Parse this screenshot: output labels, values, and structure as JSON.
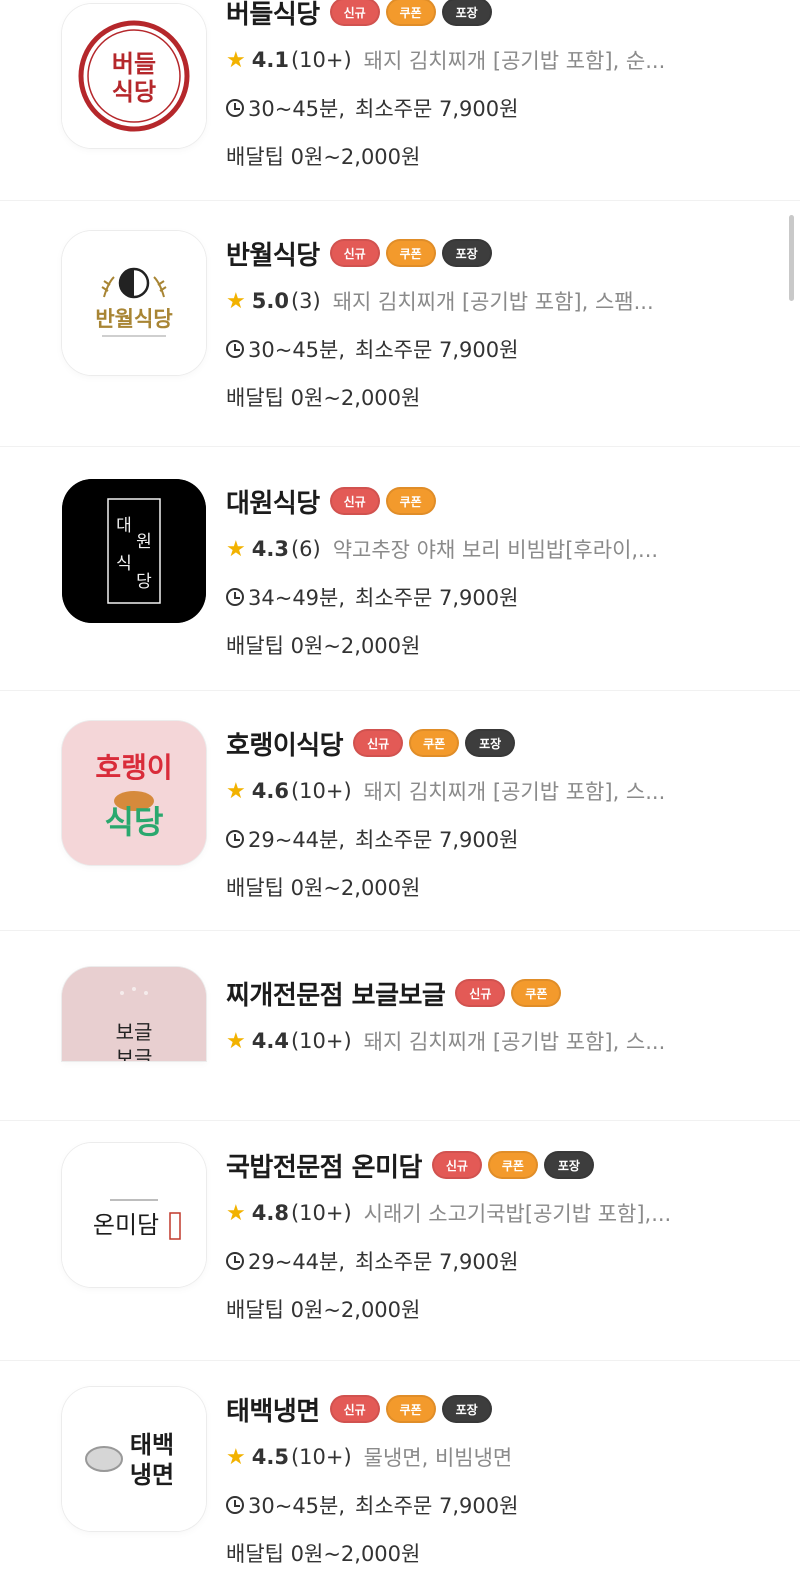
{
  "badges": {
    "new": "신규",
    "coupon": "쿠폰",
    "pack": "포장"
  },
  "restaurants": [
    {
      "name": "버들식당",
      "logo_text": [
        "버들",
        "식당"
      ],
      "rating": "4.1",
      "count": "(10+)",
      "menu": "돼지 김치찌개 [공기밥 포함], 순...",
      "time": "30~45분,",
      "min_order": "최소주문 7,900원",
      "delivery_tip": "배달팁 0원~2,000원"
    },
    {
      "name": "반월식당",
      "logo_text": [
        "반월식당"
      ],
      "rating": "5.0",
      "count": "(3)",
      "menu": "돼지 김치찌개 [공기밥 포함], 스팸...",
      "time": "30~45분,",
      "min_order": "최소주문 7,900원",
      "delivery_tip": "배달팁 0원~2,000원"
    },
    {
      "name": "대원식당",
      "logo_text": [
        "대",
        "원",
        "식",
        "당"
      ],
      "rating": "4.3",
      "count": "(6)",
      "menu": "약고추장 야채 보리 비빔밥[후라이,...",
      "time": "34~49분,",
      "min_order": "최소주문 7,900원",
      "delivery_tip": "배달팁 0원~2,000원"
    },
    {
      "name": "호랭이식당",
      "logo_text": [
        "호랭이",
        "식당"
      ],
      "rating": "4.6",
      "count": "(10+)",
      "menu": "돼지 김치찌개 [공기밥 포함], 스...",
      "time": "29~44분,",
      "min_order": "최소주문 7,900원",
      "delivery_tip": "배달팁 0원~2,000원"
    },
    {
      "name": "찌개전문점 보글보글",
      "logo_text": [
        "보글",
        "보글"
      ],
      "rating": "4.4",
      "count": "(10+)",
      "menu": "돼지 김치찌개 [공기밥 포함], 스..."
    },
    {
      "name": "국밥전문점 온미담",
      "logo_text": [
        "온미담"
      ],
      "rating": "4.8",
      "count": "(10+)",
      "menu": "시래기 소고기국밥[공기밥 포함],...",
      "time": "29~44분,",
      "min_order": "최소주문 7,900원",
      "delivery_tip": "배달팁 0원~2,000원"
    },
    {
      "name": "태백냉면",
      "logo_text": [
        "태백",
        "냉면"
      ],
      "rating": "4.5",
      "count": "(10+)",
      "menu": "물냉면, 비빔냉면",
      "time": "30~45분,",
      "min_order": "최소주문 7,900원",
      "delivery_tip": "배달팁 0원~2,000원"
    }
  ],
  "colors": {
    "badge_new": "#e35a56",
    "badge_coupon": "#f39a2c",
    "badge_pack": "#3d3d3d",
    "star": "#f2b200",
    "menu_text": "#8a8a8a"
  },
  "icons": {
    "rating": "star-icon",
    "delivery_time": "clock-icon"
  }
}
